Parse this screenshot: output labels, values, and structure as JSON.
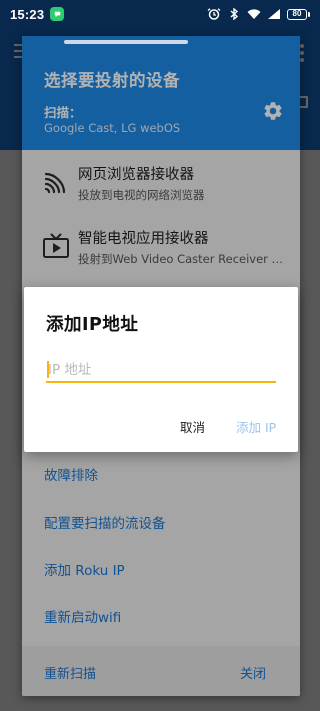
{
  "statusbar": {
    "time": "15:23",
    "battery": "80"
  },
  "sheet": {
    "title": "选择要投射的设备",
    "scan_label": "扫描：",
    "scan_value": "Google Cast, LG webOS",
    "receivers": [
      {
        "title": "网页浏览器接收器",
        "subtitle": "投放到电视的网络浏览器",
        "icon": "cast-wifi-icon"
      },
      {
        "title": "智能电视应用接收器",
        "subtitle": "投射到Web Video Caster Receiver 应用",
        "icon": "tv-play-icon"
      }
    ],
    "links": [
      "故障排除",
      "配置要扫描的流设备",
      "添加 Roku IP",
      "重新启动wifi"
    ],
    "footer": {
      "rescan": "重新扫描",
      "close": "关闭"
    }
  },
  "dialog": {
    "title": "添加IP地址",
    "ip_placeholder": "IP 地址",
    "ip_value": "",
    "cancel": "取消",
    "add": "添加 IP"
  },
  "colors": {
    "header_blue": "#1e88e5",
    "link_blue": "#1976d2",
    "accent_yellow": "#f6b40d",
    "disabled_button": "#9ec5ec"
  }
}
